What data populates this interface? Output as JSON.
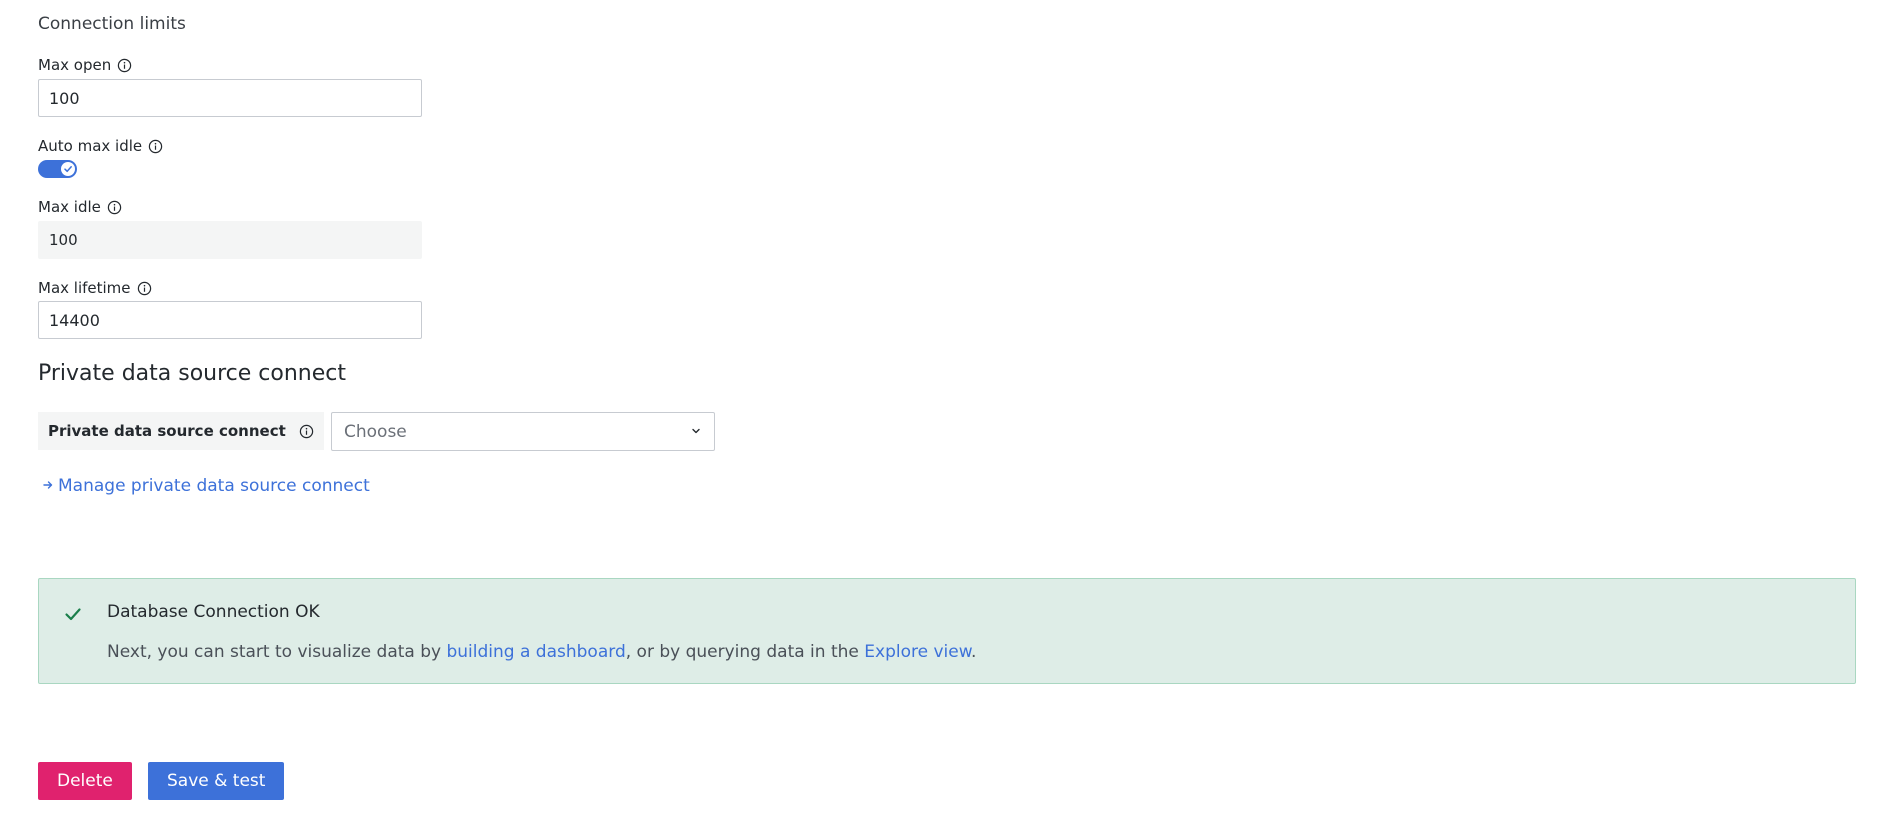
{
  "connection_limits": {
    "title": "Connection limits",
    "max_open": {
      "label": "Max open",
      "value": "100"
    },
    "auto_max_idle": {
      "label": "Auto max idle",
      "enabled": true
    },
    "max_idle": {
      "label": "Max idle",
      "value": "100"
    },
    "max_lifetime": {
      "label": "Max lifetime",
      "value": "14400"
    }
  },
  "private_data_source": {
    "heading": "Private data source connect",
    "label": "Private data source connect",
    "select_placeholder": "Choose",
    "manage_link": "Manage private data source connect"
  },
  "alert": {
    "title": "Database Connection OK",
    "text_before": "Next, you can start to visualize data by ",
    "link1": "building a dashboard",
    "text_middle": ", or by querying data in the ",
    "link2": "Explore view",
    "text_after": "."
  },
  "actions": {
    "delete_label": "Delete",
    "save_label": "Save & test"
  },
  "colors": {
    "primary": "#3d71d9",
    "danger": "#e0226e",
    "success_bg": "#deede7",
    "success_icon": "#1a7f4b"
  }
}
